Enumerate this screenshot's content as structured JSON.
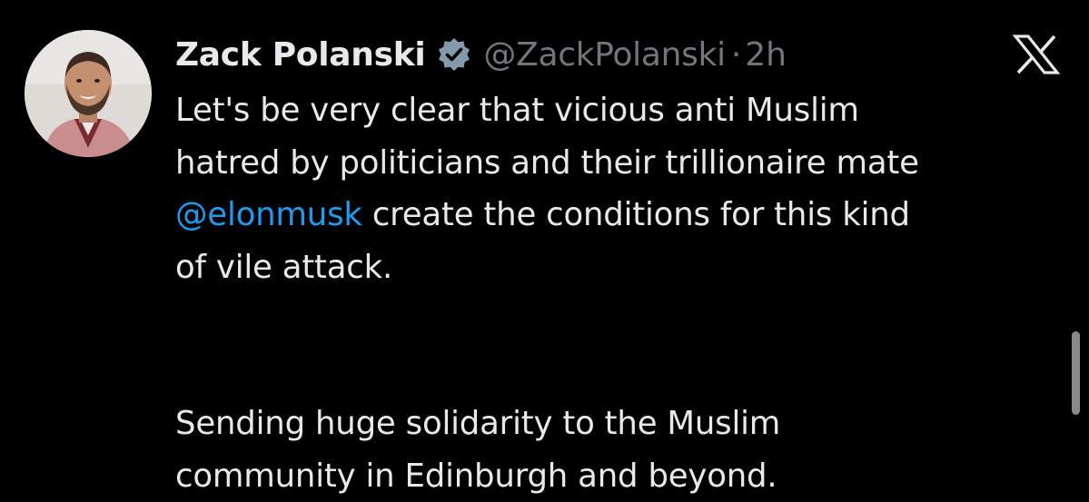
{
  "author": {
    "name": "Zack Polanski",
    "handle": "@ZackPolanski",
    "separator": "·",
    "time": "2h",
    "verified": true
  },
  "icons": {
    "avatar": "profile-photo",
    "verified": "verified-badge-icon",
    "platform": "x-logo-icon"
  },
  "tweet": {
    "para1": {
      "line1": "Let's be very clear that vicious anti Muslim",
      "line2": "hatred by politicians and their trillionaire mate",
      "mention": "@elonmusk",
      "line3_rest": " create the conditions for this kind",
      "line4": "of vile attack."
    },
    "para2": {
      "line1": "Sending huge solidarity to the Muslim",
      "line2": "community in Edinburgh and beyond."
    }
  },
  "colors": {
    "background": "#000000",
    "text": "#e7e9ea",
    "secondary": "#71767b",
    "link": "#1d9bf0"
  }
}
